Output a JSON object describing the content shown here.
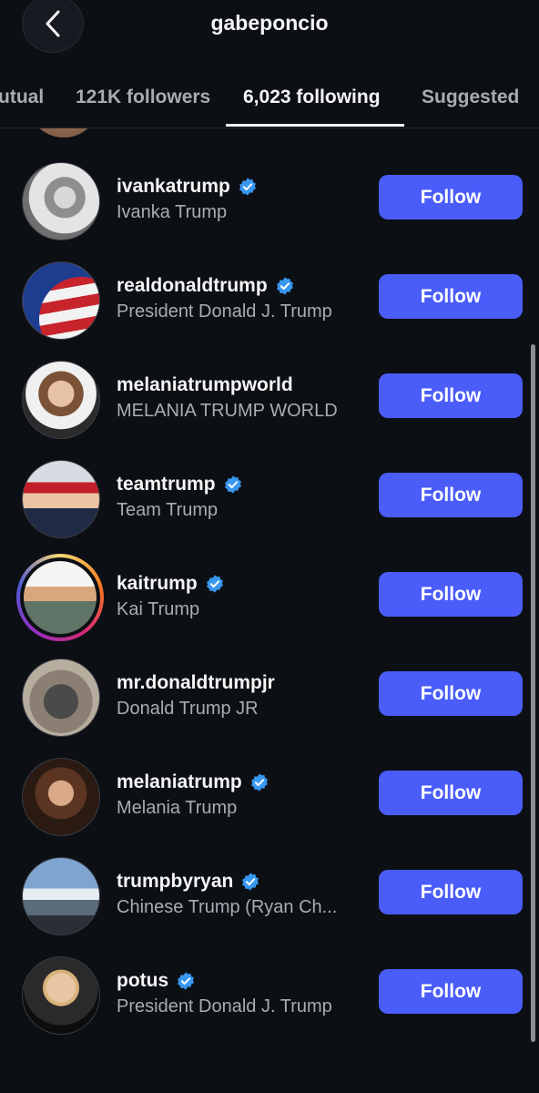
{
  "header": {
    "title": "gabeponcio",
    "back_icon": "chevron-left-icon"
  },
  "tabs": [
    {
      "label": "utual",
      "active": false
    },
    {
      "label": "121K followers",
      "active": false
    },
    {
      "label": "6,023 following",
      "active": true
    },
    {
      "label": "Suggested",
      "active": false
    }
  ],
  "accounts": [
    {
      "handle": "ivankatrump",
      "name": "Ivanka Trump",
      "verified": true,
      "button": "Follow"
    },
    {
      "handle": "realdonaldtrump",
      "name": "President Donald J. Trump",
      "verified": true,
      "button": "Follow"
    },
    {
      "handle": "melaniatrumpworld",
      "name": "MELANIA TRUMP WORLD",
      "verified": false,
      "button": "Follow"
    },
    {
      "handle": "teamtrump",
      "name": "Team Trump",
      "verified": true,
      "button": "Follow"
    },
    {
      "handle": "kaitrump",
      "name": "Kai Trump",
      "verified": true,
      "button": "Follow"
    },
    {
      "handle": "mr.donaldtrumpjr",
      "name": "Donald Trump JR",
      "verified": false,
      "button": "Follow"
    },
    {
      "handle": "melaniatrump",
      "name": "Melania Trump",
      "verified": true,
      "button": "Follow"
    },
    {
      "handle": "trumpbyryan",
      "name": "Chinese Trump (Ryan Ch...",
      "verified": true,
      "button": "Follow"
    },
    {
      "handle": "potus",
      "name": "President Donald J. Trump",
      "verified": true,
      "button": "Follow"
    }
  ],
  "colors": {
    "accent": "#4a5df9",
    "verified_badge": "#3897f0",
    "background": "#0c0f14"
  }
}
